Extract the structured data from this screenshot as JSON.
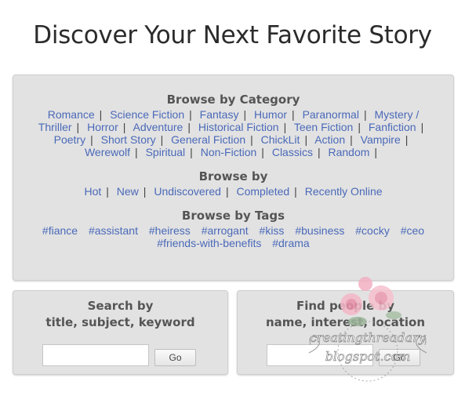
{
  "page": {
    "title": "Discover Your Next Favorite Story"
  },
  "browse_category": {
    "heading": "Browse by Category",
    "items": [
      "Romance",
      "Science Fiction",
      "Fantasy",
      "Humor",
      "Paranormal",
      "Mystery / Thriller",
      "Horror",
      "Adventure",
      "Historical Fiction",
      "Teen Fiction",
      "Fanfiction",
      "Poetry",
      "Short Story",
      "General Fiction",
      "ChickLit",
      "Action",
      "Vampire",
      "Werewolf",
      "Spiritual",
      "Non-Fiction",
      "Classics",
      "Random"
    ]
  },
  "browse_by": {
    "heading": "Browse by",
    "items": [
      "Hot",
      "New",
      "Undiscovered",
      "Completed",
      "Recently Online"
    ]
  },
  "browse_tags": {
    "heading": "Browse by Tags",
    "items": [
      "#fiance",
      "#assistant",
      "#heiress",
      "#arrogant",
      "#kiss",
      "#business",
      "#cocky",
      "#ceo",
      "#friends-with-benefits",
      "#drama"
    ]
  },
  "search": {
    "heading_line1": "Search by",
    "heading_line2": "title, subject, keyword",
    "input_value": "",
    "go_label": "Go"
  },
  "people": {
    "heading_line1": "Find people by",
    "heading_line2": "name, interest, location",
    "input_value": "",
    "go_label": "Go"
  },
  "watermark": {
    "line1": "creatingthreadary",
    "line2": "blogspot.com",
    "color": "#f2b3c6"
  },
  "colors": {
    "link": "#4a69b8",
    "panel_bg": "#e2e2e2",
    "heading": "#555555"
  }
}
